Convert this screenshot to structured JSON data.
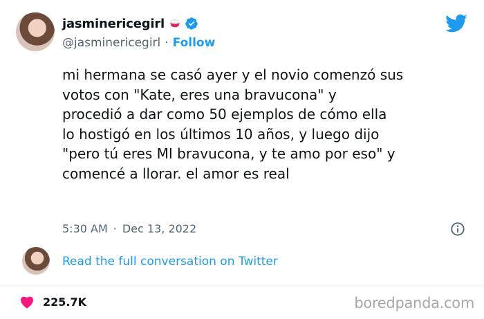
{
  "author": {
    "name": "jasminericegirl",
    "handle": "@jasminericegirl",
    "separator": "·",
    "follow_label": "Follow"
  },
  "tweet": {
    "text": "mi hermana se casó ayer y el novio comenzó sus\nvotos con \"Kate, eres una bravucona\" y\nprocedió a dar como 50 ejemplos de cómo ella\nlo hostigó en los últimos 10 años, y luego dijo\n\"pero tú eres MI bravucona, y te amo por eso\" y\ncomencé a llorar. el amor es real",
    "time": "5:30 AM",
    "separator": "·",
    "date": "Dec 13, 2022"
  },
  "conversation": {
    "link_label": "Read the full conversation on Twitter"
  },
  "engagement": {
    "likes": "225.7K"
  },
  "watermark": "boredpanda.com",
  "colors": {
    "accent": "#1d9bf0",
    "secondary_text": "#536471",
    "heart": "#f91880"
  },
  "icons": [
    "rice-bowl-icon",
    "verified-badge-icon",
    "twitter-bird-icon",
    "info-icon",
    "heart-icon"
  ]
}
